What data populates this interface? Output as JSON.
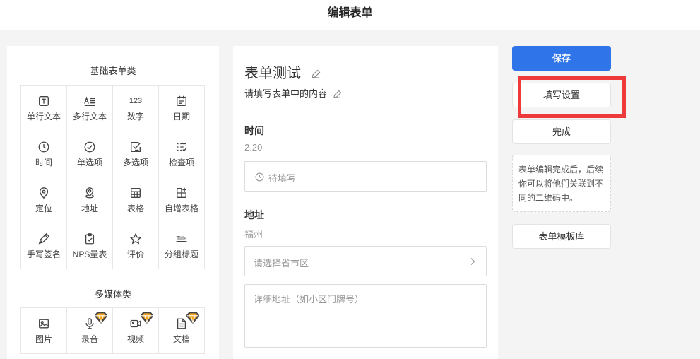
{
  "header": {
    "title": "编辑表单"
  },
  "palette": {
    "basic_title": "基础表单类",
    "basic_items": [
      {
        "label": "单行文本",
        "icon": "single-line-text-icon"
      },
      {
        "label": "多行文本",
        "icon": "multi-line-text-icon"
      },
      {
        "label": "数字",
        "icon": "number-icon",
        "glyph": "123"
      },
      {
        "label": "日期",
        "icon": "calendar-icon"
      },
      {
        "label": "时间",
        "icon": "clock-icon"
      },
      {
        "label": "单选项",
        "icon": "radio-check-icon"
      },
      {
        "label": "多选项",
        "icon": "checkbox-icon"
      },
      {
        "label": "检查项",
        "icon": "checklist-icon"
      },
      {
        "label": "定位",
        "icon": "location-pin-icon"
      },
      {
        "label": "地址",
        "icon": "address-pin-icon"
      },
      {
        "label": "表格",
        "icon": "table-icon"
      },
      {
        "label": "自增表格",
        "icon": "table-add-icon"
      },
      {
        "label": "手写签名",
        "icon": "pen-icon"
      },
      {
        "label": "NPS量表",
        "icon": "clipboard-icon"
      },
      {
        "label": "评价",
        "icon": "star-icon"
      },
      {
        "label": "分组标题",
        "icon": "title-icon",
        "glyph": "Title"
      }
    ],
    "media_title": "多媒体类",
    "media_items": [
      {
        "label": "图片",
        "icon": "image-icon",
        "premium": false
      },
      {
        "label": "录音",
        "icon": "microphone-icon",
        "premium": true
      },
      {
        "label": "视频",
        "icon": "video-icon",
        "premium": true
      },
      {
        "label": "文档",
        "icon": "document-icon",
        "premium": true
      }
    ]
  },
  "form": {
    "title": "表单测试",
    "subtitle": "请填写表单中的内容",
    "time_field": {
      "label": "时间",
      "value": "2.20",
      "placeholder": "待填写"
    },
    "address_field": {
      "label": "地址",
      "value": "福州",
      "region_placeholder": "请选择省市区",
      "detail_placeholder": "详细地址（如小区门牌号）"
    }
  },
  "actions": {
    "save": "保存",
    "fill_settings": "填写设置",
    "done": "完成",
    "hint": "表单编辑完成后，后续你可以将他们关联到不同的二维码中。",
    "template_library": "表单模板库"
  },
  "colors": {
    "primary": "#2f74e8",
    "highlight": "#ee3a3a",
    "premium": "#f2a623"
  }
}
